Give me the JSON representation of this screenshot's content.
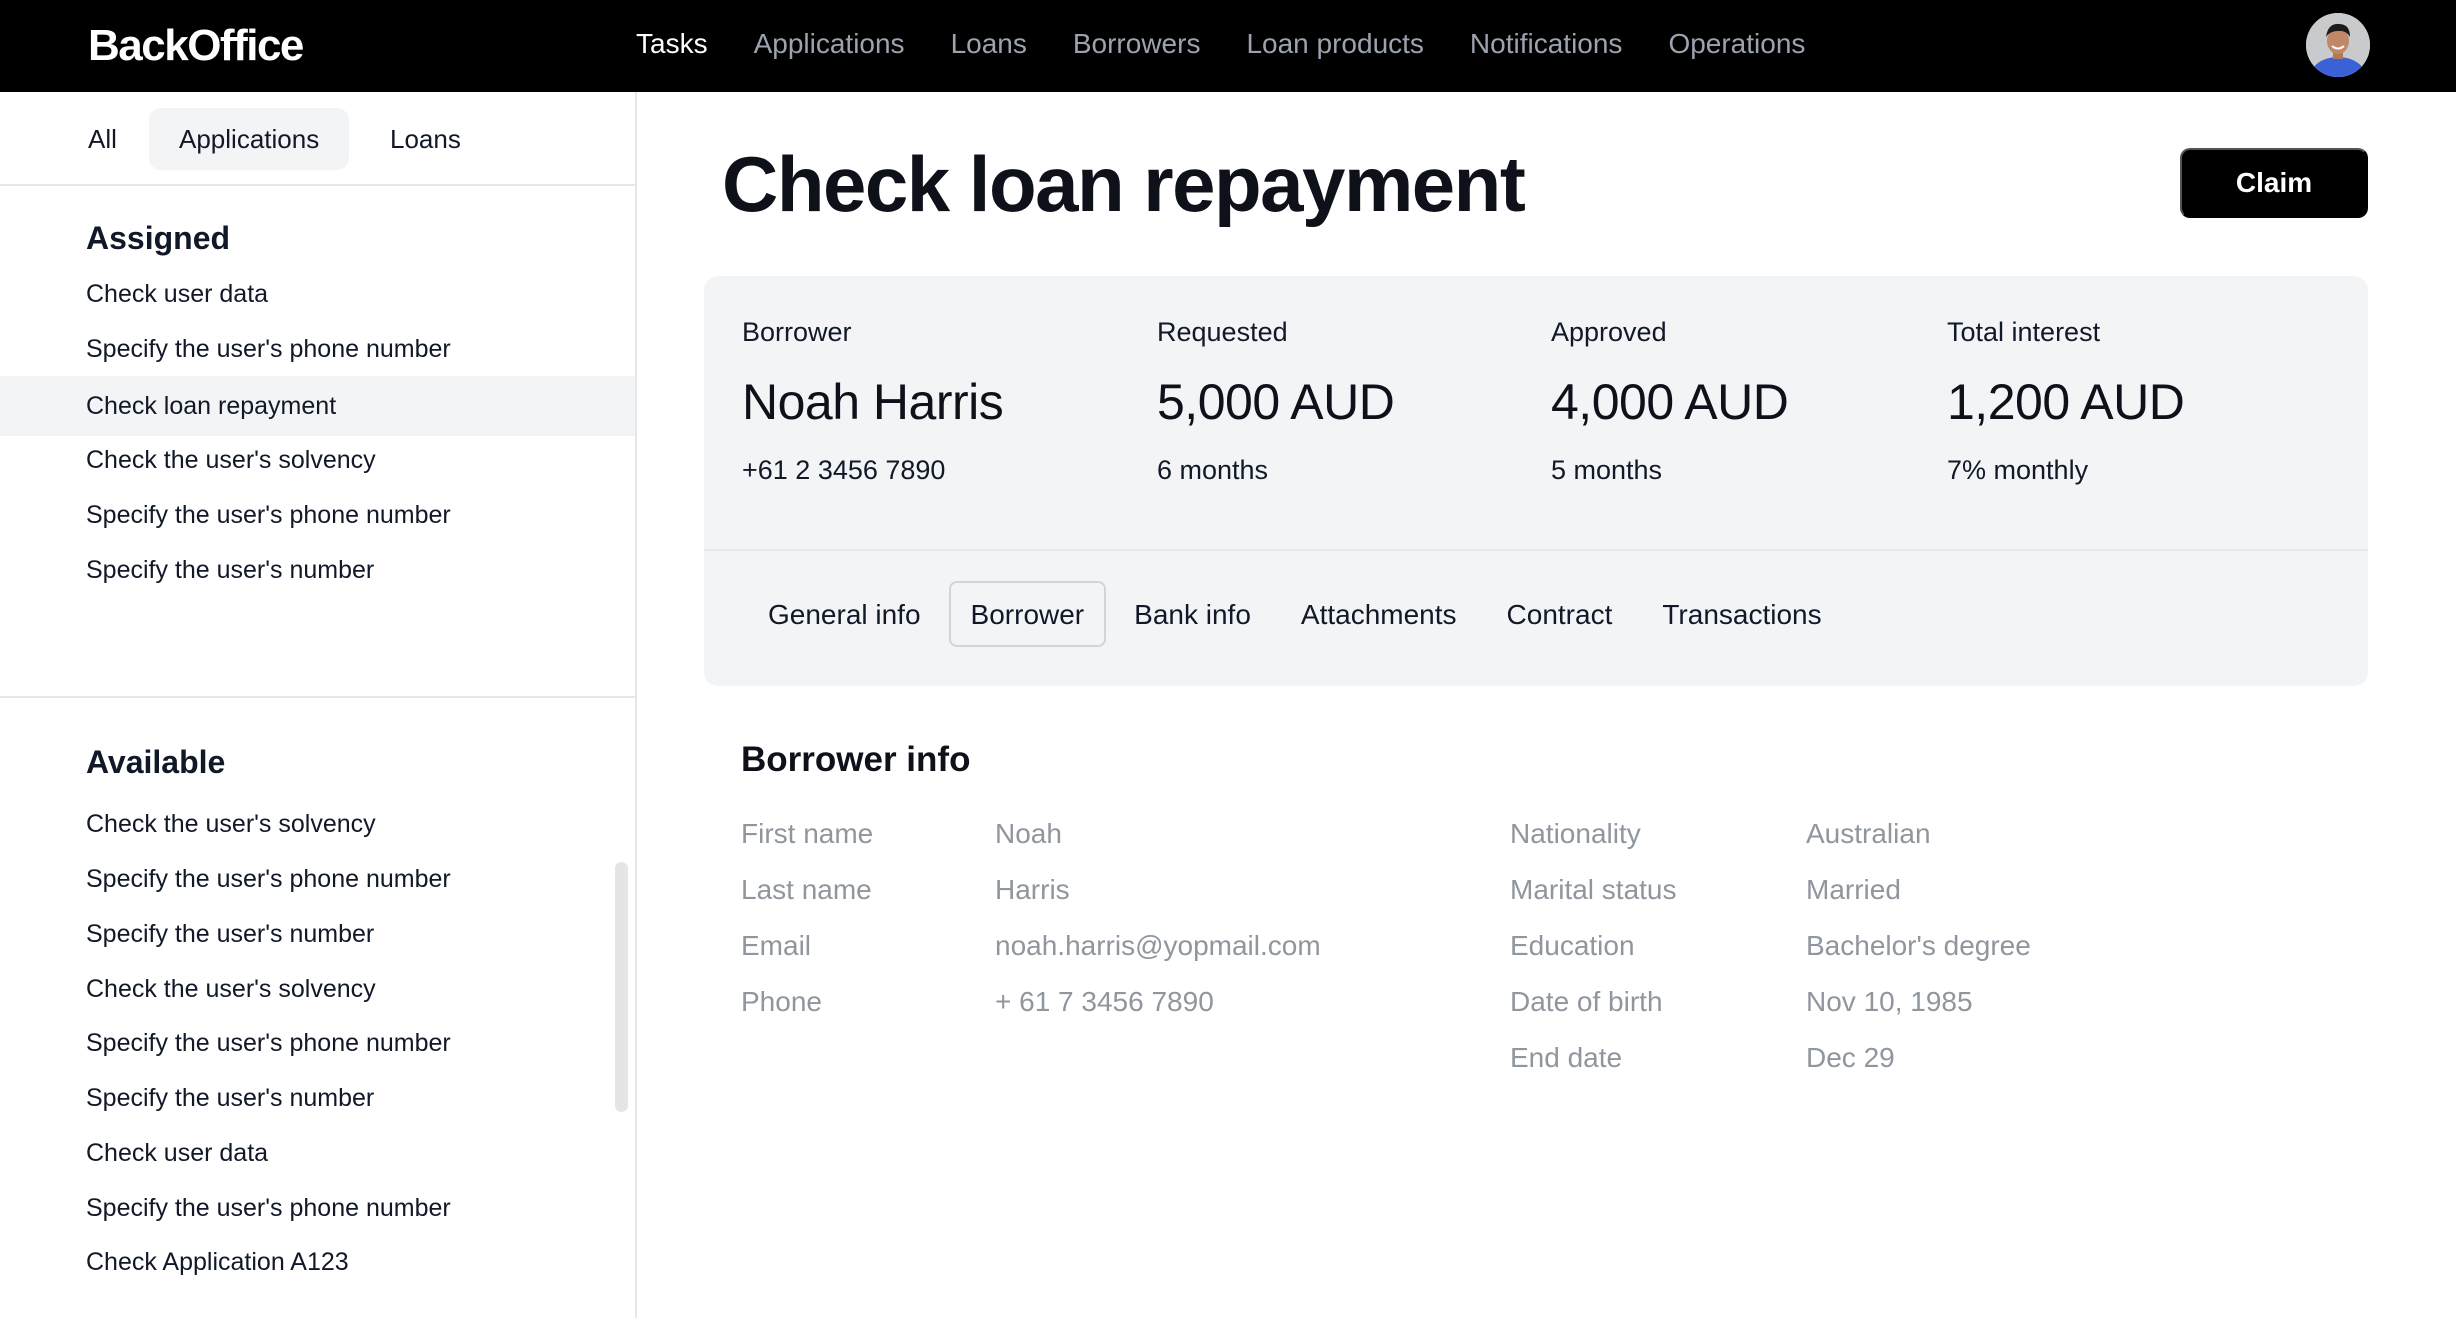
{
  "app": {
    "name": "BackOffice",
    "nav": [
      {
        "label": "Tasks",
        "active": true
      },
      {
        "label": "Applications",
        "active": false
      },
      {
        "label": "Loans",
        "active": false
      },
      {
        "label": "Borrowers",
        "active": false
      },
      {
        "label": "Loan products",
        "active": false
      },
      {
        "label": "Notifications",
        "active": false
      },
      {
        "label": "Operations",
        "active": false
      }
    ],
    "avatar_icon": "user-avatar"
  },
  "sidebar": {
    "filters": [
      {
        "label": "All",
        "active": false
      },
      {
        "label": "Applications",
        "active": true
      },
      {
        "label": "Loans",
        "active": false
      }
    ],
    "assigned": {
      "title": "Assigned",
      "items": [
        {
          "label": "Check user data",
          "selected": false
        },
        {
          "label": "Specify the user's phone number",
          "selected": false
        },
        {
          "label": "Check loan repayment",
          "selected": true
        },
        {
          "label": "Check the user's solvency",
          "selected": false
        },
        {
          "label": "Specify the user's phone number",
          "selected": false
        },
        {
          "label": "Specify the user's number",
          "selected": false
        }
      ]
    },
    "available": {
      "title": "Available",
      "items": [
        {
          "label": "Check the user's solvency"
        },
        {
          "label": "Specify the user's phone number"
        },
        {
          "label": "Specify the user's number"
        },
        {
          "label": "Check the user's solvency"
        },
        {
          "label": "Specify the user's phone number"
        },
        {
          "label": "Specify the user's number"
        },
        {
          "label": "Check user data"
        },
        {
          "label": "Specify the user's phone number"
        },
        {
          "label": "Check Application A123"
        }
      ]
    }
  },
  "main": {
    "title": "Check loan repayment",
    "claim_label": "Claim",
    "summary": [
      {
        "label": "Borrower",
        "value": "Noah Harris",
        "sub": "+61 2 3456 7890"
      },
      {
        "label": "Requested",
        "value": "5,000 AUD",
        "sub": "6 months"
      },
      {
        "label": "Approved",
        "value": "4,000 AUD",
        "sub": "5 months"
      },
      {
        "label": "Total interest",
        "value": "1,200 AUD",
        "sub": "7% monthly"
      }
    ],
    "tabs": [
      {
        "label": "General info",
        "active": false
      },
      {
        "label": "Borrower",
        "active": true
      },
      {
        "label": "Bank info",
        "active": false
      },
      {
        "label": "Attachments",
        "active": false
      },
      {
        "label": "Contract",
        "active": false
      },
      {
        "label": "Transactions",
        "active": false
      }
    ],
    "borrower_info": {
      "title": "Borrower info",
      "left": [
        {
          "label": "First name",
          "value": "Noah"
        },
        {
          "label": "Last name",
          "value": "Harris"
        },
        {
          "label": "Email",
          "value": "noah.harris@yopmail.com"
        },
        {
          "label": "Phone",
          "value": "+ 61 7 3456 7890"
        }
      ],
      "right": [
        {
          "label": "Nationality",
          "value": "Australian"
        },
        {
          "label": "Marital status",
          "value": "Married"
        },
        {
          "label": "Education",
          "value": "Bachelor's degree"
        },
        {
          "label": "Date of birth",
          "value": "Nov 10, 1985"
        },
        {
          "label": "End date",
          "value": "Dec 29"
        }
      ]
    }
  },
  "colors": {
    "topbar": "#000000",
    "nav_active": "#ffffff",
    "nav_inactive": "#9ca3af",
    "panel_bg": "#f3f4f6",
    "muted_text": "#8f969e",
    "primary_button": "#000000"
  }
}
